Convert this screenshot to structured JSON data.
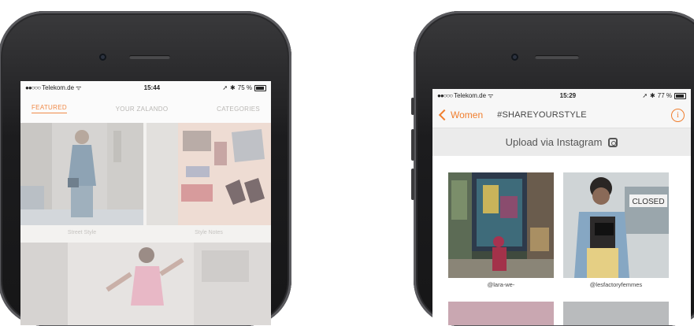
{
  "left_phone": {
    "status": {
      "carrier": "Telekom.de",
      "time": "15:44",
      "battery": "75 %"
    },
    "tabs": [
      {
        "label": "FEATURED",
        "active": true
      },
      {
        "label": "YOUR ZALANDO",
        "active": false
      },
      {
        "label": "CATEGORIES",
        "active": false
      }
    ],
    "tiles": [
      {
        "caption": "Street Style"
      },
      {
        "caption": "Style Notes"
      }
    ]
  },
  "right_phone": {
    "status": {
      "carrier": "Telekom.de",
      "time": "15:29",
      "battery": "77 %"
    },
    "nav": {
      "back_label": "Women",
      "title": "#SHAREYOURSTYLE",
      "info_icon": "info-icon"
    },
    "upload": {
      "label": "Upload via Instagram",
      "icon": "instagram-icon"
    },
    "posts": [
      {
        "handle": "@lara-we-"
      },
      {
        "handle": "@lesfactoryfemmes"
      }
    ],
    "closed_sign": "CLOSED"
  },
  "colors": {
    "accent": "#f07e2e",
    "tab_inactive": "#b9b7b4"
  }
}
